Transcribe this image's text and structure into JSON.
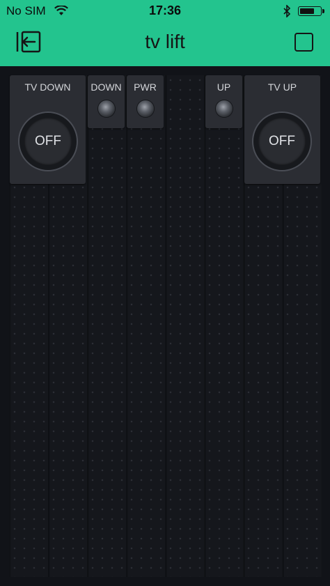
{
  "status_bar": {
    "carrier": "No SIM",
    "time": "17:36",
    "battery_level": 0.75
  },
  "header": {
    "title": "tv lift"
  },
  "widgets": {
    "tv_down": {
      "label": "TV DOWN",
      "state": "OFF"
    },
    "down": {
      "label": "DOWN"
    },
    "pwr": {
      "label": "PWR"
    },
    "up": {
      "label": "UP"
    },
    "tv_up": {
      "label": "TV UP",
      "state": "OFF"
    }
  },
  "colors": {
    "header": "#23c48e",
    "background": "#111318",
    "widget": "#2b2d33"
  }
}
